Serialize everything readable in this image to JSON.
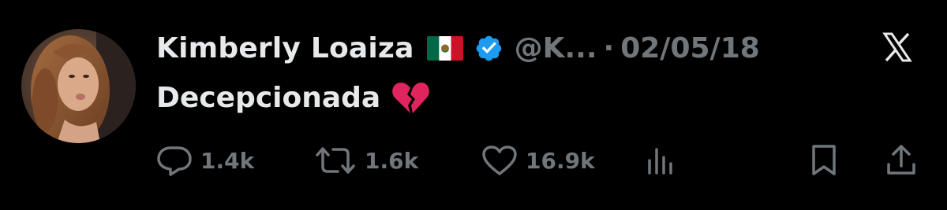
{
  "tweet": {
    "author_name": "Kimberly Loaiza",
    "flag_icon": "mexico-flag-icon",
    "verified_icon": "verified-badge-icon",
    "handle": "@K...",
    "separator": "·",
    "date": "02/05/18",
    "text": "Decepcionada",
    "emoji_icon": "broken-heart-icon"
  },
  "actions": {
    "replies": "1.4k",
    "reposts": "1.6k",
    "likes": "16.9k"
  },
  "colors": {
    "background": "#000000",
    "primary_text": "#e7e9ea",
    "secondary_text": "#71767b",
    "verified": "#1d9bf0",
    "broken_heart": "#e0245e"
  }
}
